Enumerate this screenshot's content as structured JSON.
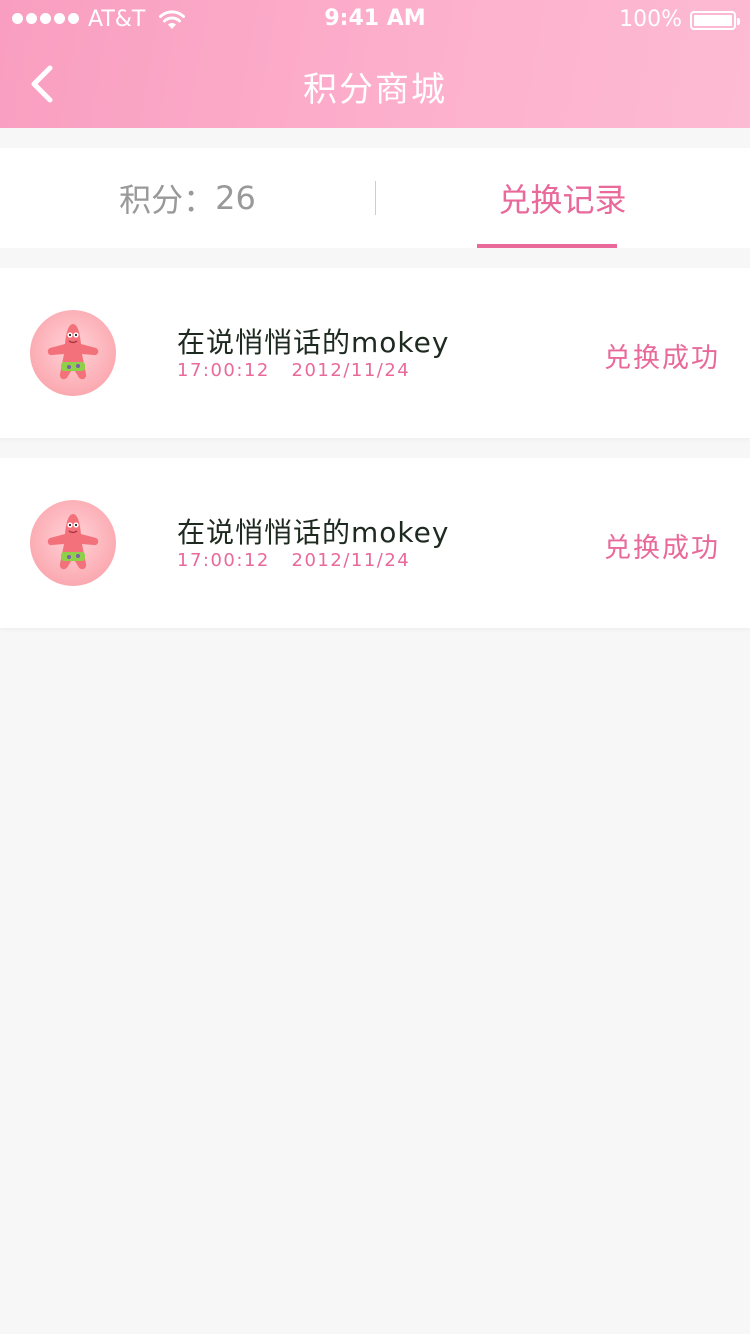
{
  "status_bar": {
    "carrier": "AT&T",
    "time": "9:41 AM",
    "battery": "100%"
  },
  "header": {
    "title": "积分商城"
  },
  "tabs": {
    "points_label": "积分：",
    "points_value": "26",
    "records_label": "兑换记录"
  },
  "records": [
    {
      "name": "在说悄悄话的mokey",
      "time": "17:00:12",
      "date": "2012/11/24",
      "status": "兑换成功"
    },
    {
      "name": "在说悄悄话的mokey",
      "time": "17:00:12",
      "date": "2012/11/24",
      "status": "兑换成功"
    }
  ],
  "colors": {
    "accent": "#e8699a",
    "header_start": "#f99ec0",
    "header_end": "#fdbad3"
  },
  "icons": {
    "back": "chevron-left-icon",
    "wifi": "wifi-icon",
    "battery": "battery-icon"
  }
}
